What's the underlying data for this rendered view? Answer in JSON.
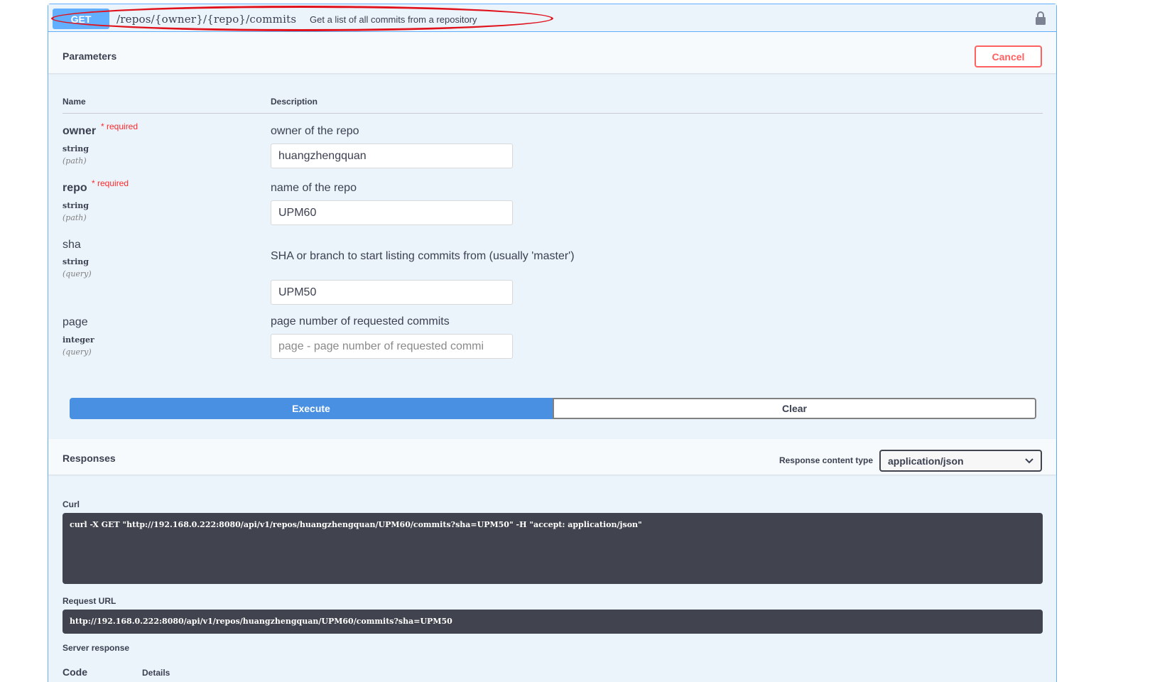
{
  "summary": {
    "method": "GET",
    "path": "/repos/{owner}/{repo}/commits",
    "description": "Get a list of all commits from a repository"
  },
  "parameters": {
    "title": "Parameters",
    "cancel_label": "Cancel",
    "col_name": "Name",
    "col_description": "Description",
    "required_label": "* required",
    "items": [
      {
        "name": "owner",
        "type": "string",
        "in": "(path)",
        "description": "owner of the repo",
        "value": "huangzhengquan",
        "placeholder": ""
      },
      {
        "name": "repo",
        "type": "string",
        "in": "(path)",
        "description": "name of the repo",
        "value": "UPM60",
        "placeholder": ""
      },
      {
        "name": "sha",
        "type": "string",
        "in": "(query)",
        "description": "SHA or branch to start listing commits from (usually 'master')",
        "value": "UPM50",
        "placeholder": ""
      },
      {
        "name": "page",
        "type": "integer",
        "in": "(query)",
        "description": "page number of requested commits",
        "value": "",
        "placeholder": "page - page number of requested commi"
      }
    ]
  },
  "actions": {
    "execute_label": "Execute",
    "clear_label": "Clear"
  },
  "responses": {
    "title": "Responses",
    "content_type_label": "Response content type",
    "content_type_value": "application/json",
    "curl_label": "Curl",
    "curl_command": "curl -X GET \"http://192.168.0.222:8080/api/v1/repos/huangzhengquan/UPM60/commits?sha=UPM50\" -H \"accept: application/json\"",
    "request_url_label": "Request URL",
    "request_url": "http://192.168.0.222:8080/api/v1/repos/huangzhengquan/UPM60/commits?sha=UPM50",
    "server_response_label": "Server response",
    "code_label": "Code",
    "details_label": "Details"
  },
  "icons": {
    "lock": "lock-icon",
    "select_arrow": "chevron-down-icon"
  },
  "colors": {
    "get_accent": "#61affe",
    "execute": "#4990e2",
    "cancel": "#ff6060",
    "annotation": "#e0121c",
    "code_bg": "#41444e"
  }
}
